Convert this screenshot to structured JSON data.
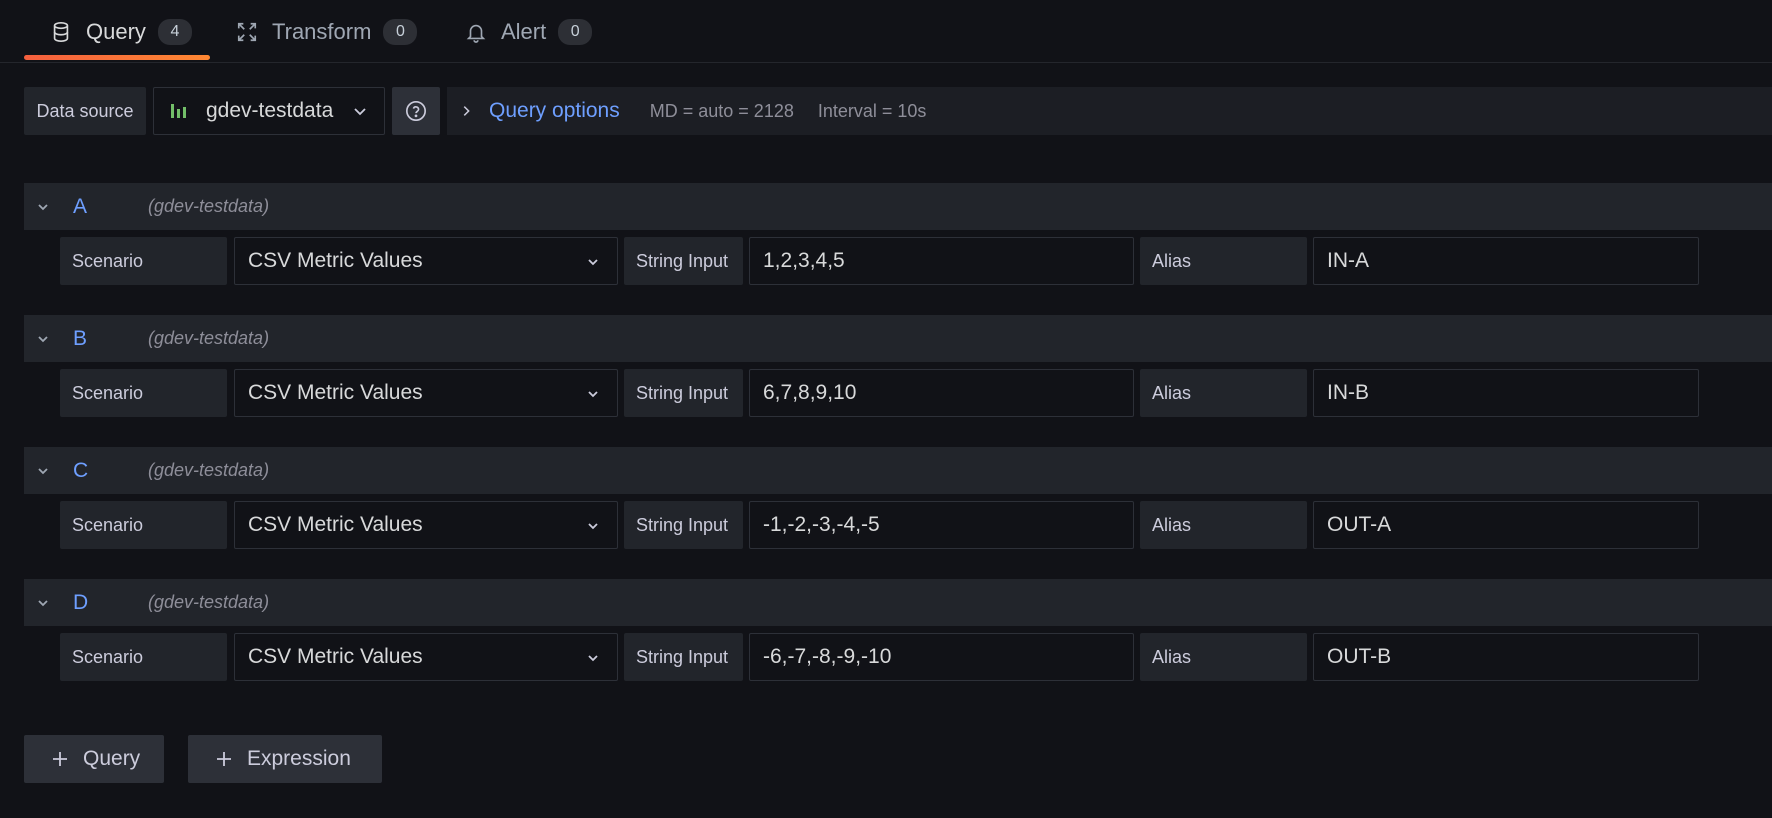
{
  "tabs": [
    {
      "label": "Query",
      "count": "4",
      "icon": "database-icon",
      "active": true
    },
    {
      "label": "Transform",
      "count": "0",
      "icon": "transform-icon",
      "active": false
    },
    {
      "label": "Alert",
      "count": "0",
      "icon": "bell-icon",
      "active": false
    }
  ],
  "datasource": {
    "label": "Data source",
    "selected": "gdev-testdata",
    "query_options_label": "Query options",
    "md": "MD = auto = 2128",
    "interval": "Interval = 10s"
  },
  "field_labels": {
    "scenario": "Scenario",
    "string_input": "String Input",
    "alias": "Alias"
  },
  "queries": [
    {
      "ref": "A",
      "datasource": "(gdev-testdata)",
      "scenario": "CSV Metric Values",
      "string_input": "1,2,3,4,5",
      "alias": "IN-A"
    },
    {
      "ref": "B",
      "datasource": "(gdev-testdata)",
      "scenario": "CSV Metric Values",
      "string_input": "6,7,8,9,10",
      "alias": "IN-B"
    },
    {
      "ref": "C",
      "datasource": "(gdev-testdata)",
      "scenario": "CSV Metric Values",
      "string_input": "-1,-2,-3,-4,-5",
      "alias": "OUT-A"
    },
    {
      "ref": "D",
      "datasource": "(gdev-testdata)",
      "scenario": "CSV Metric Values",
      "string_input": "-6,-7,-8,-9,-10",
      "alias": "OUT-B"
    }
  ],
  "buttons": {
    "add_query": "Query",
    "add_expression": "Expression"
  },
  "colors": {
    "accent_blue": "#6e9fff",
    "active_tab_underline": "#f55f3e",
    "background": "#111217"
  }
}
